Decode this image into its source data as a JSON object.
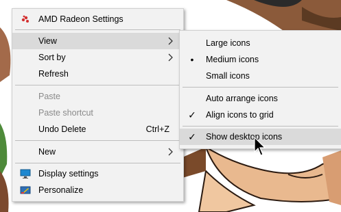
{
  "main_menu": {
    "app_item": {
      "label": "AMD Radeon Settings",
      "icon": "amd-radeon-icon"
    },
    "view": {
      "label": "View",
      "has_submenu": true
    },
    "sort_by": {
      "label": "Sort by",
      "has_submenu": true
    },
    "refresh": {
      "label": "Refresh"
    },
    "paste": {
      "label": "Paste",
      "disabled": true
    },
    "paste_shortcut": {
      "label": "Paste shortcut",
      "disabled": true
    },
    "undo_delete": {
      "label": "Undo Delete",
      "shortcut": "Ctrl+Z"
    },
    "new": {
      "label": "New",
      "has_submenu": true
    },
    "display_settings": {
      "label": "Display settings",
      "icon": "display-icon"
    },
    "personalize": {
      "label": "Personalize",
      "icon": "personalize-icon"
    }
  },
  "view_submenu": {
    "large_icons": {
      "label": "Large icons",
      "checked": false
    },
    "medium_icons": {
      "label": "Medium icons",
      "checked": true,
      "mark": "•"
    },
    "small_icons": {
      "label": "Small icons",
      "checked": false
    },
    "auto_arrange": {
      "label": "Auto arrange icons",
      "checked": false
    },
    "align_to_grid": {
      "label": "Align icons to grid",
      "checked": true,
      "mark": "✓"
    },
    "show_desktop_icons": {
      "label": "Show desktop icons",
      "checked": true,
      "mark": "✓"
    }
  },
  "colors": {
    "menu_bg": "#f2f2f2",
    "highlight": "#dadada",
    "disabled_text": "#8a8a8a",
    "amd_red": "#d32f2f"
  }
}
